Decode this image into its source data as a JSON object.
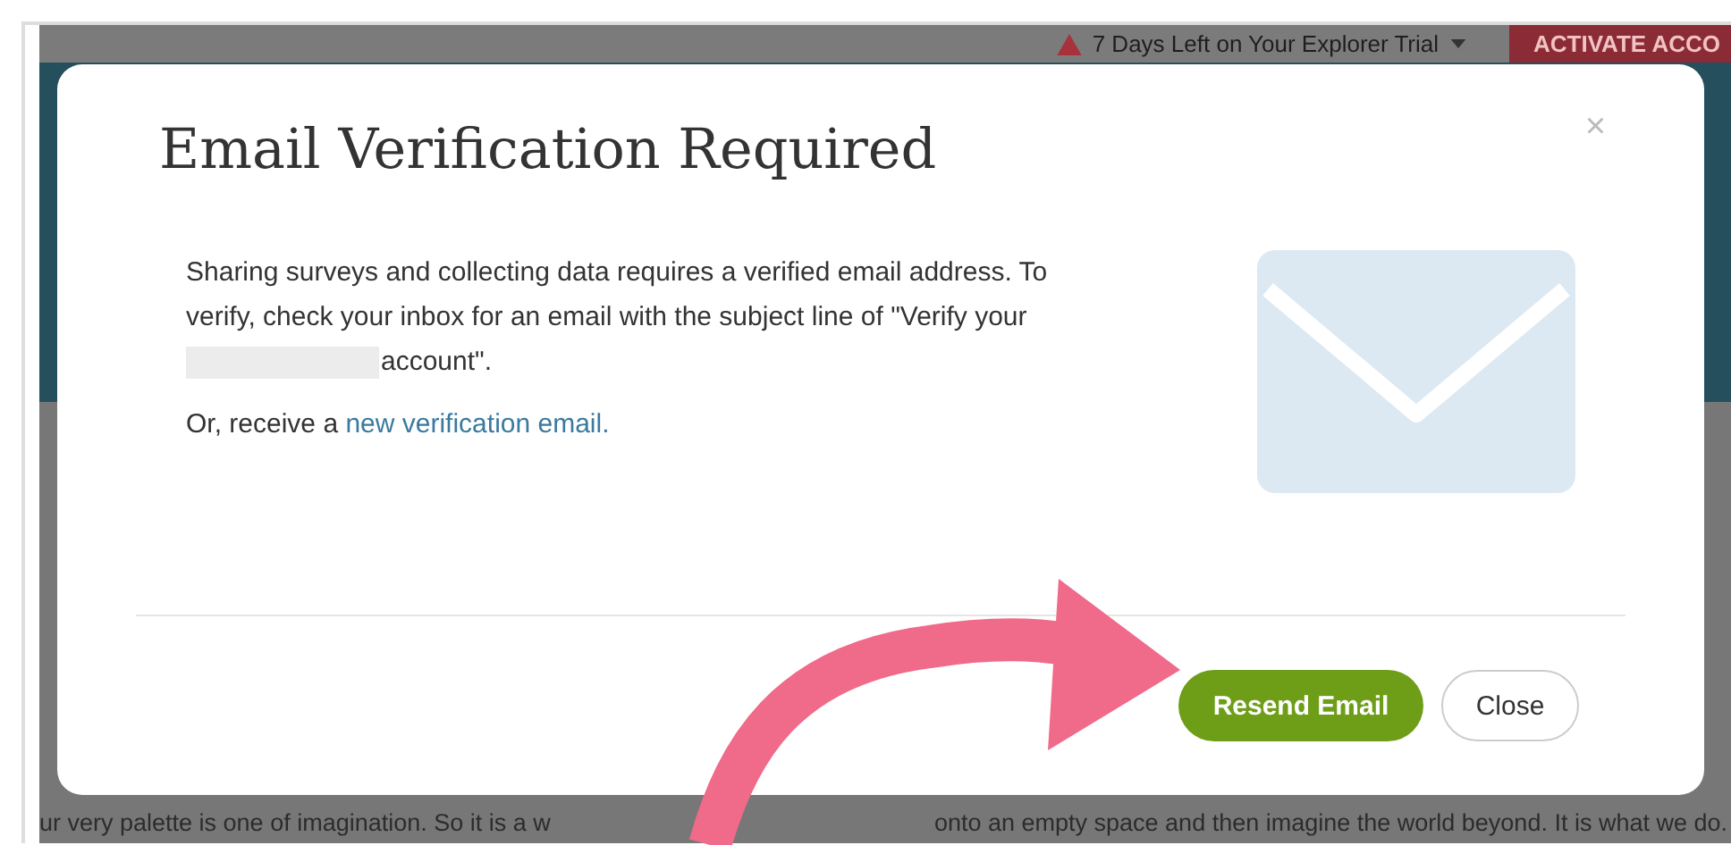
{
  "background_page": {
    "trial_notice": "7 Days Left on Your Explorer Trial",
    "activate_button": "ACTIVATE ACCO",
    "body_text_left": "ur very palette is one of imagination. So it is a w",
    "body_text_right": "onto an empty space and then imagine the world beyond. It is what we do."
  },
  "modal": {
    "title": "Email Verification Required",
    "close_symbol": "×",
    "paragraph_before": "Sharing surveys and collecting data requires a verified email address. To verify, check your inbox for an email with the subject line of \"Verify your",
    "paragraph_after": "account\".",
    "resend_prefix": "Or, receive a",
    "resend_link": "new verification email.",
    "buttons": [
      {
        "kind": "primary",
        "label": "Resend Email"
      },
      {
        "kind": "secondary",
        "label": "Close"
      }
    ]
  }
}
